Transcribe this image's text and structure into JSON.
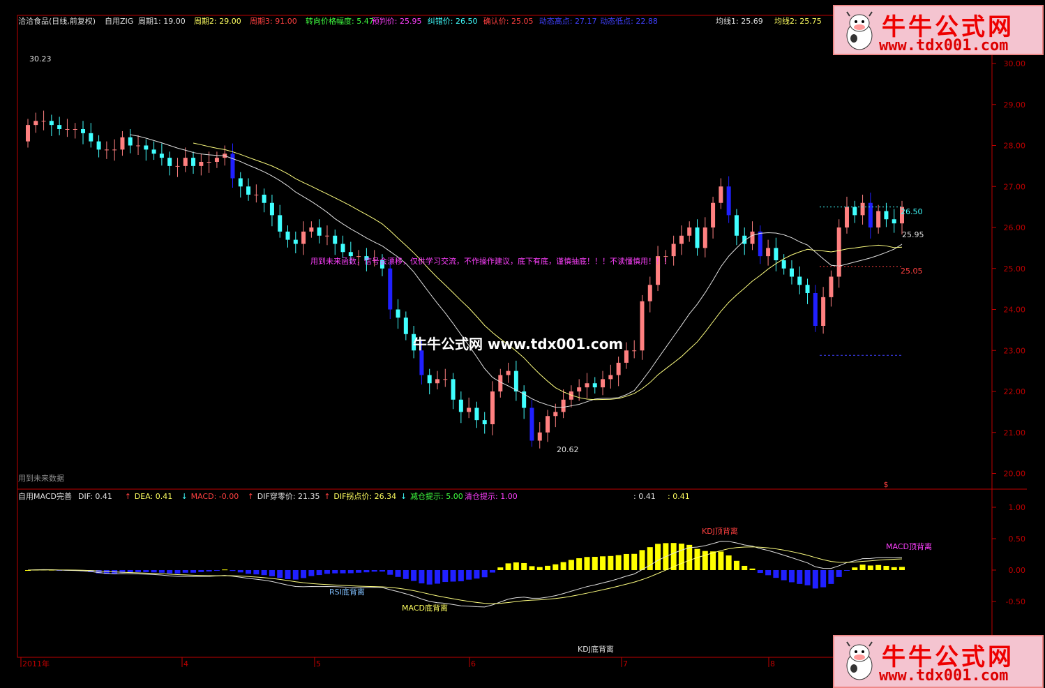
{
  "header": {
    "title": "洽洽食品(日线,前复权)",
    "indicator": "自用ZIG",
    "params": [
      {
        "text": "周期1: 19.00",
        "color": "#e0e0e0"
      },
      {
        "text": "周期2: 29.00",
        "color": "#ffff60"
      },
      {
        "text": "周期3: 91.00",
        "color": "#ff4040"
      },
      {
        "text": "转向价格幅度: 5.47",
        "color": "#40ff40"
      },
      {
        "text": "预判价: 25.95",
        "color": "#ff40ff"
      },
      {
        "text": "纠错价: 26.50",
        "color": "#40ffff"
      },
      {
        "text": "确认价: 25.05",
        "color": "#ff4040"
      },
      {
        "text": "动态高点: 27.17",
        "color": "#4040ff"
      },
      {
        "text": "动态低点: 22.88",
        "color": "#4040ff"
      }
    ],
    "ma": [
      {
        "text": "均线1: 25.69",
        "color": "#e0e0e0"
      },
      {
        "text": "均线2: 25.75",
        "color": "#ffff60"
      }
    ]
  },
  "annotations": {
    "high_label": "30.23",
    "low_label": "20.62",
    "warning": "用到未来函数，信号会漂移，仅供学习交流，不作操作建议，底下有底，谨慎抽底！！！不读懂慎用！！！",
    "future_data": "用到未来数据",
    "watermark": "牛牛公式网 www.tdx001.com",
    "level_2650": "26.50",
    "level_2595": "25.95",
    "level_2505": "25.05",
    "dollar": "$"
  },
  "macd_header": {
    "name": "自用MACD完善",
    "items": [
      {
        "text": "DIF: 0.41",
        "color": "#e0e0e0",
        "arrow": "↑",
        "arrow_color": "#ff4040"
      },
      {
        "text": "DEA: 0.41",
        "color": "#ffff60",
        "arrow": "↓",
        "arrow_color": "#40ffff"
      },
      {
        "text": "MACD: -0.00",
        "color": "#ff4040",
        "arrow": "↑",
        "arrow_color": "#ff4040"
      },
      {
        "text": "DIF穿零价: 21.35",
        "color": "#e0e0e0",
        "arrow": "↑",
        "arrow_color": "#ff4040"
      },
      {
        "text": "DIF拐点价: 26.34",
        "color": "#ffff60",
        "arrow": "↓",
        "arrow_color": "#40ffff"
      },
      {
        "text": "减仓提示: 5.00",
        "color": "#40ff40",
        "arrow": "",
        "arrow_color": ""
      },
      {
        "text": "清仓提示: 1.00",
        "color": "#ff40ff",
        "arrow": "",
        "arrow_color": ""
      }
    ],
    "extra1": ": 0.41",
    "extra2": ": 0.41"
  },
  "macd_labels": {
    "rsi_div": "RSI底背离",
    "macd_div": "MACD底背离",
    "kdj_bottom": "KDJ底背离",
    "kdj_top": "KDJ顶背离",
    "macd_top": "MACD顶背离"
  },
  "xaxis": [
    "2011年",
    "4",
    "5",
    "6",
    "7",
    "8"
  ],
  "banner": {
    "site": "牛牛公式网",
    "url": "www.tdx001.com"
  },
  "colors": {
    "up": "#ff8080",
    "down": "#40ffff",
    "down_strong": "#2020ff",
    "axis": "#c00000",
    "ma1": "#e0e0e0",
    "ma2": "#ffff80"
  },
  "chart_data": [
    {
      "type": "candlestick",
      "title": "洽洽食品(日线,前复权)",
      "ylim": [
        19.5,
        30.5
      ],
      "yticks": [
        20.0,
        21.0,
        22.0,
        23.0,
        24.0,
        25.0,
        26.0,
        27.0,
        28.0,
        29.0,
        30.0
      ],
      "close_approx": [
        28.5,
        28.6,
        28.6,
        28.5,
        28.4,
        28.4,
        28.4,
        28.3,
        28.1,
        27.9,
        27.9,
        27.9,
        28.2,
        28.0,
        28.0,
        27.9,
        27.8,
        27.7,
        27.5,
        27.5,
        27.7,
        27.5,
        27.6,
        27.6,
        27.7,
        27.8,
        27.2,
        27.0,
        26.8,
        26.8,
        26.6,
        26.3,
        25.9,
        25.7,
        25.6,
        25.9,
        26.0,
        25.8,
        25.8,
        25.6,
        25.4,
        25.3,
        25.3,
        25.2,
        25.2,
        25.0,
        24.0,
        23.8,
        23.4,
        23.0,
        22.4,
        22.2,
        22.3,
        22.3,
        21.8,
        21.5,
        21.6,
        21.3,
        21.2,
        22.0,
        22.4,
        22.5,
        22.0,
        21.6,
        20.8,
        21.0,
        21.4,
        21.5,
        21.8,
        22.0,
        22.1,
        22.2,
        22.1,
        22.3,
        22.4,
        22.7,
        23.0,
        23.0,
        24.2,
        24.6,
        25.3,
        25.3,
        25.6,
        25.8,
        26.0,
        25.5,
        26.0,
        26.6,
        27.0,
        26.3,
        25.8,
        25.6,
        25.9,
        25.3,
        25.5,
        25.2,
        25.0,
        24.8,
        24.6,
        24.4,
        23.6,
        24.3,
        24.8,
        26.0,
        26.5,
        26.3,
        26.6,
        26.0,
        26.4,
        26.2,
        26.1,
        26.5
      ]
    },
    {
      "type": "bar",
      "title": "自用MACD完善",
      "ylim": [
        -0.8,
        1.3
      ],
      "yticks": [
        -0.5,
        0.0,
        0.5,
        1.0
      ]
    }
  ]
}
